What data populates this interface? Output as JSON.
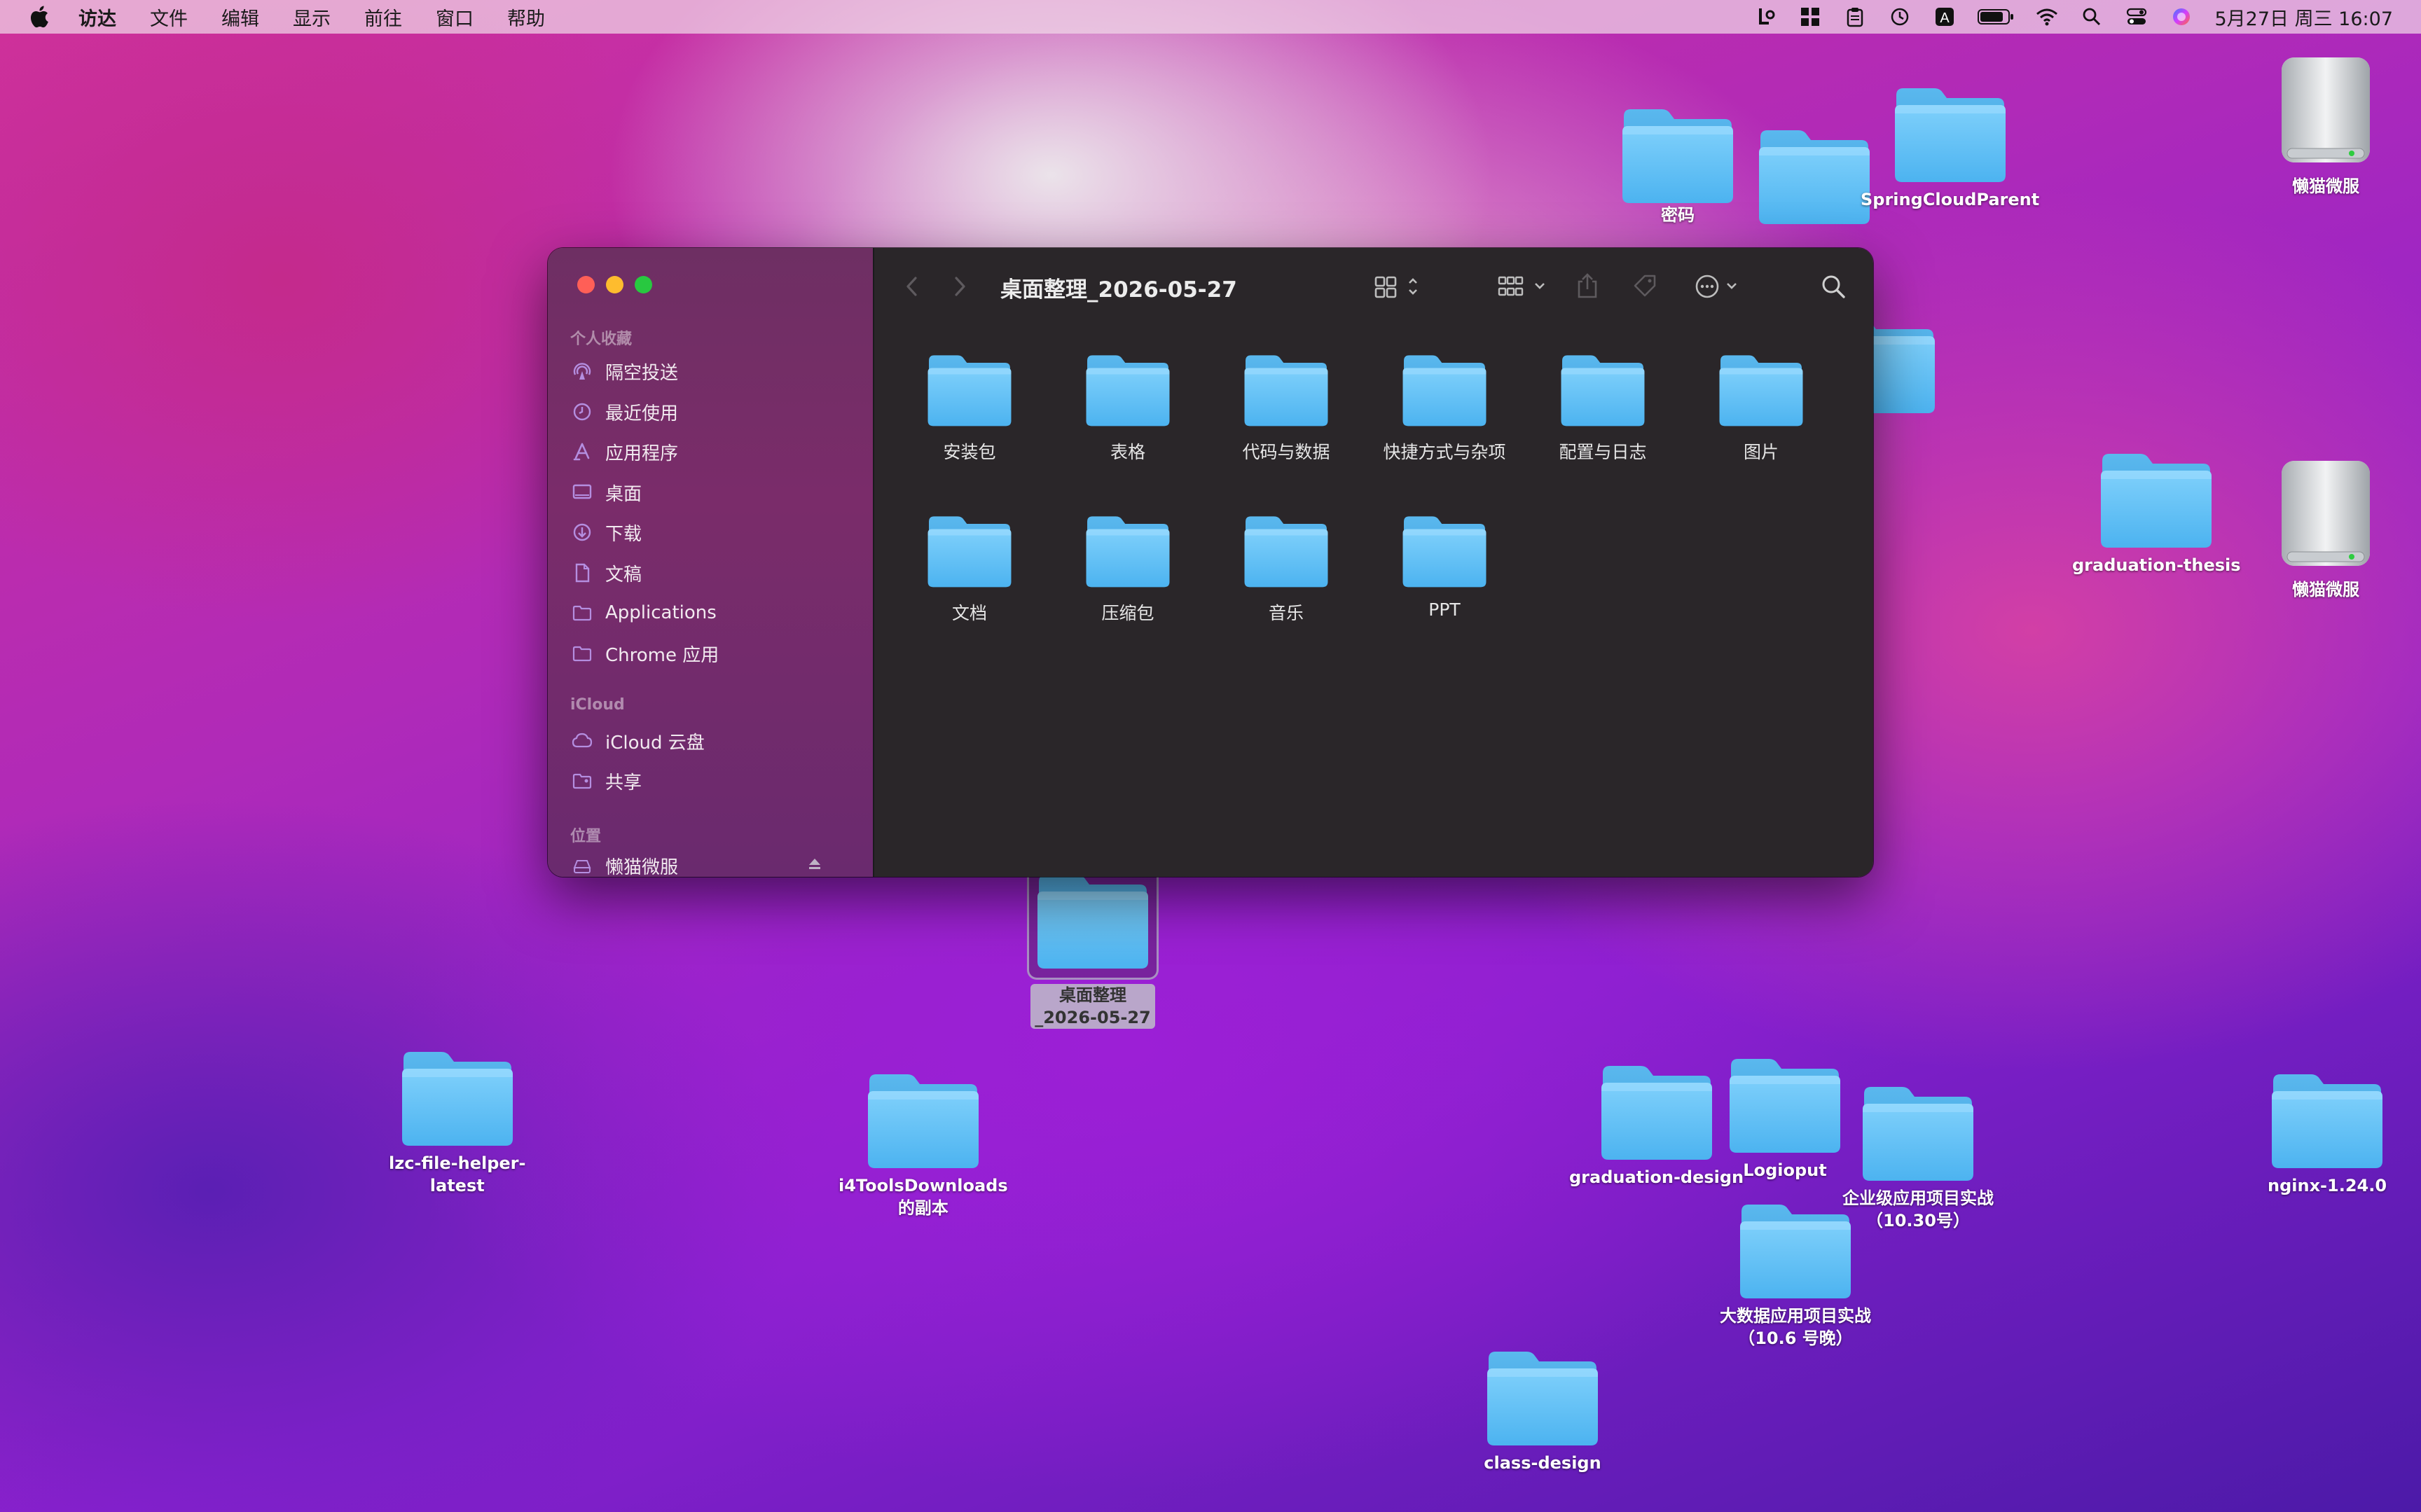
{
  "menubar": {
    "items": [
      "访达",
      "文件",
      "编辑",
      "显示",
      "前往",
      "窗口",
      "帮助"
    ],
    "clock": "5月27日 周三 16:07"
  },
  "desktop": {
    "icons": [
      {
        "label": "密码"
      },
      {
        "label": ""
      },
      {
        "label": "SpringCloudParent"
      },
      {
        "label": "懒猫微服"
      },
      {
        "label": "graduation-thesis"
      },
      {
        "label": "懒猫微服"
      },
      {
        "label": "桌面整理\n_2026-05-27"
      },
      {
        "label": "lzc-file-helper-\nlatest"
      },
      {
        "label": "i4ToolsDownloads\n的副本"
      },
      {
        "label": "graduation-design"
      },
      {
        "label": "Logioput"
      },
      {
        "label": "企业级应用项目实战\n（10.30号）"
      },
      {
        "label": "nginx-1.24.0"
      },
      {
        "label": "大数据应用项目实战\n（10.6 号晚）"
      },
      {
        "label": "class-design"
      }
    ]
  },
  "finder": {
    "title": "桌面整理_2026-05-27",
    "sidebar": {
      "sections": [
        "个人收藏",
        "iCloud",
        "位置"
      ],
      "favorites": [
        "隔空投送",
        "最近使用",
        "应用程序",
        "桌面",
        "下载",
        "文稿",
        "Applications",
        "Chrome 应用"
      ],
      "icloud": [
        "iCloud 云盘",
        "共享"
      ],
      "locations": [
        "懒猫微服"
      ]
    },
    "items": [
      "安装包",
      "表格",
      "代码与数据",
      "快捷方式与杂项",
      "配置与日志",
      "图片",
      "文档",
      "压缩包",
      "音乐",
      "PPT"
    ]
  }
}
